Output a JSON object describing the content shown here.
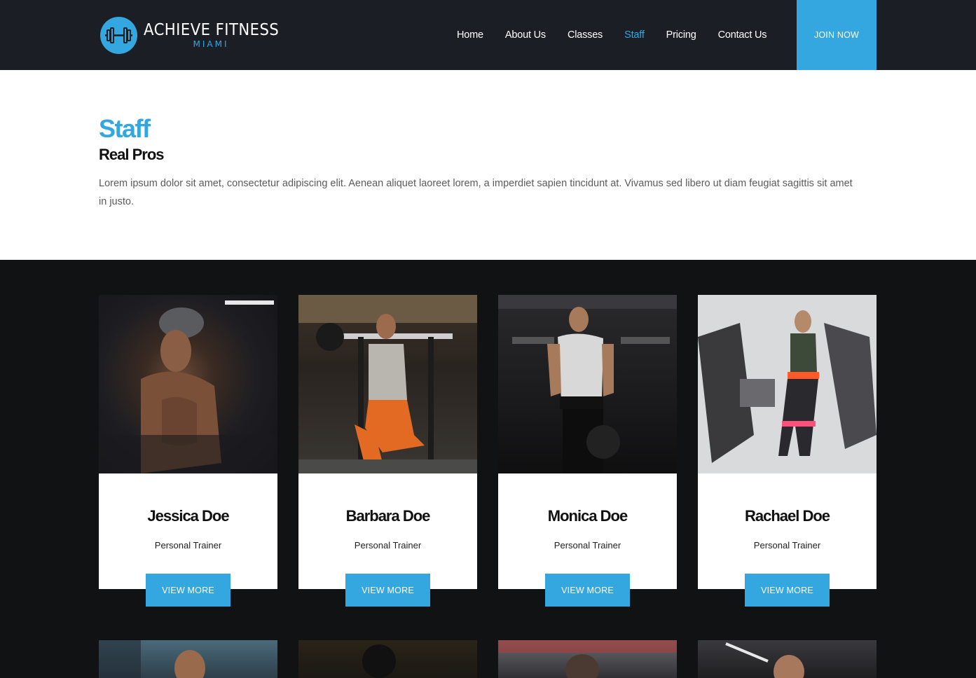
{
  "header": {
    "logo_title": "ACHIEVE FITNESS",
    "logo_sub": "MIAMI",
    "nav": [
      "Home",
      "About Us",
      "Classes",
      "Staff",
      "Pricing",
      "Contact Us"
    ],
    "active": "Staff",
    "join_label": "JOIN NOW"
  },
  "intro": {
    "title": "Staff",
    "subtitle": "Real Pros",
    "body": "Lorem ipsum dolor sit amet, consectetur adipiscing elit. Aenean aliquet laoreet lorem, a imperdiet sapien tincidunt at. Vivamus sed libero ut diam feugiat sagittis sit amet in justo."
  },
  "staff": [
    {
      "name": "Jessica Doe",
      "role": "Personal Trainer",
      "button": "VIEW MORE"
    },
    {
      "name": "Barbara Doe",
      "role": "Personal Trainer",
      "button": "VIEW MORE"
    },
    {
      "name": "Monica Doe",
      "role": "Personal Trainer",
      "button": "VIEW MORE"
    },
    {
      "name": "Rachael Doe",
      "role": "Personal Trainer",
      "button": "VIEW MORE"
    }
  ],
  "colors": {
    "accent": "#35a7e0",
    "header_bg": "#1b1e24",
    "section_bg": "#111214"
  }
}
